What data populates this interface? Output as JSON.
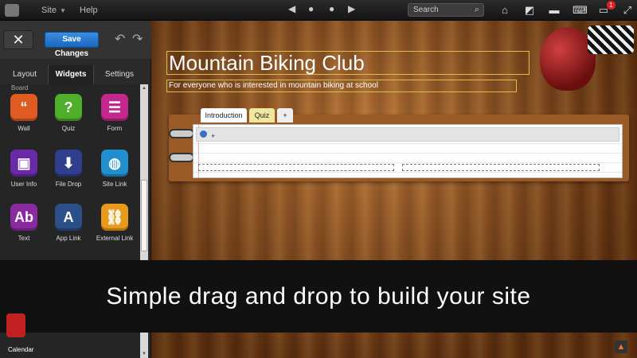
{
  "topbar": {
    "menu": {
      "site": "Site",
      "help": "Help"
    },
    "search_placeholder": "Search",
    "notification_count": "1",
    "icons": [
      "home-icon",
      "publish-icon",
      "folder-icon",
      "keyboard-icon",
      "chat-icon",
      "fullscreen-icon"
    ]
  },
  "toolbar": {
    "save_label": "Save Changes"
  },
  "tabs": [
    {
      "label": "Layout"
    },
    {
      "label": "Widgets",
      "active": true
    },
    {
      "label": "Settings"
    }
  ],
  "widgets": {
    "partial_label": "Board",
    "items": [
      {
        "label": "Wall",
        "icon": "quote-icon",
        "glyph": "“",
        "color": "#e05a24"
      },
      {
        "label": "Quiz",
        "icon": "question-icon",
        "glyph": "?",
        "color": "#4fae2a"
      },
      {
        "label": "Form",
        "icon": "form-icon",
        "glyph": "☰",
        "color": "#c2288f"
      },
      {
        "label": "User Info",
        "icon": "user-card-icon",
        "glyph": "▣",
        "color": "#6a2aa8"
      },
      {
        "label": "File Drop",
        "icon": "file-drop-icon",
        "glyph": "⬇",
        "color": "#2f3f8e"
      },
      {
        "label": "Site Link",
        "icon": "globe-icon",
        "glyph": "◍",
        "color": "#1f8fd0"
      },
      {
        "label": "Text",
        "icon": "text-icon",
        "glyph": "Ab",
        "color": "#8a2aa0"
      },
      {
        "label": "App Link",
        "icon": "app-link-icon",
        "glyph": "A",
        "color": "#2c4f8a"
      },
      {
        "label": "External Link",
        "icon": "chain-link-icon",
        "glyph": "⛓",
        "color": "#e89a1c"
      }
    ],
    "calendar_label": "Calendar"
  },
  "site": {
    "title": "Mountain Biking Club",
    "subtitle": "For everyone who is interested in mountain biking at school"
  },
  "notebook": {
    "tabs": [
      "Introduction",
      "Quiz",
      "+"
    ],
    "row_plus": "+"
  },
  "caption": "Simple drag and drop to build your site",
  "colors": {
    "accent_blue": "#1b66c0",
    "wood": "#96521f",
    "title_border": "#d8c04a"
  }
}
